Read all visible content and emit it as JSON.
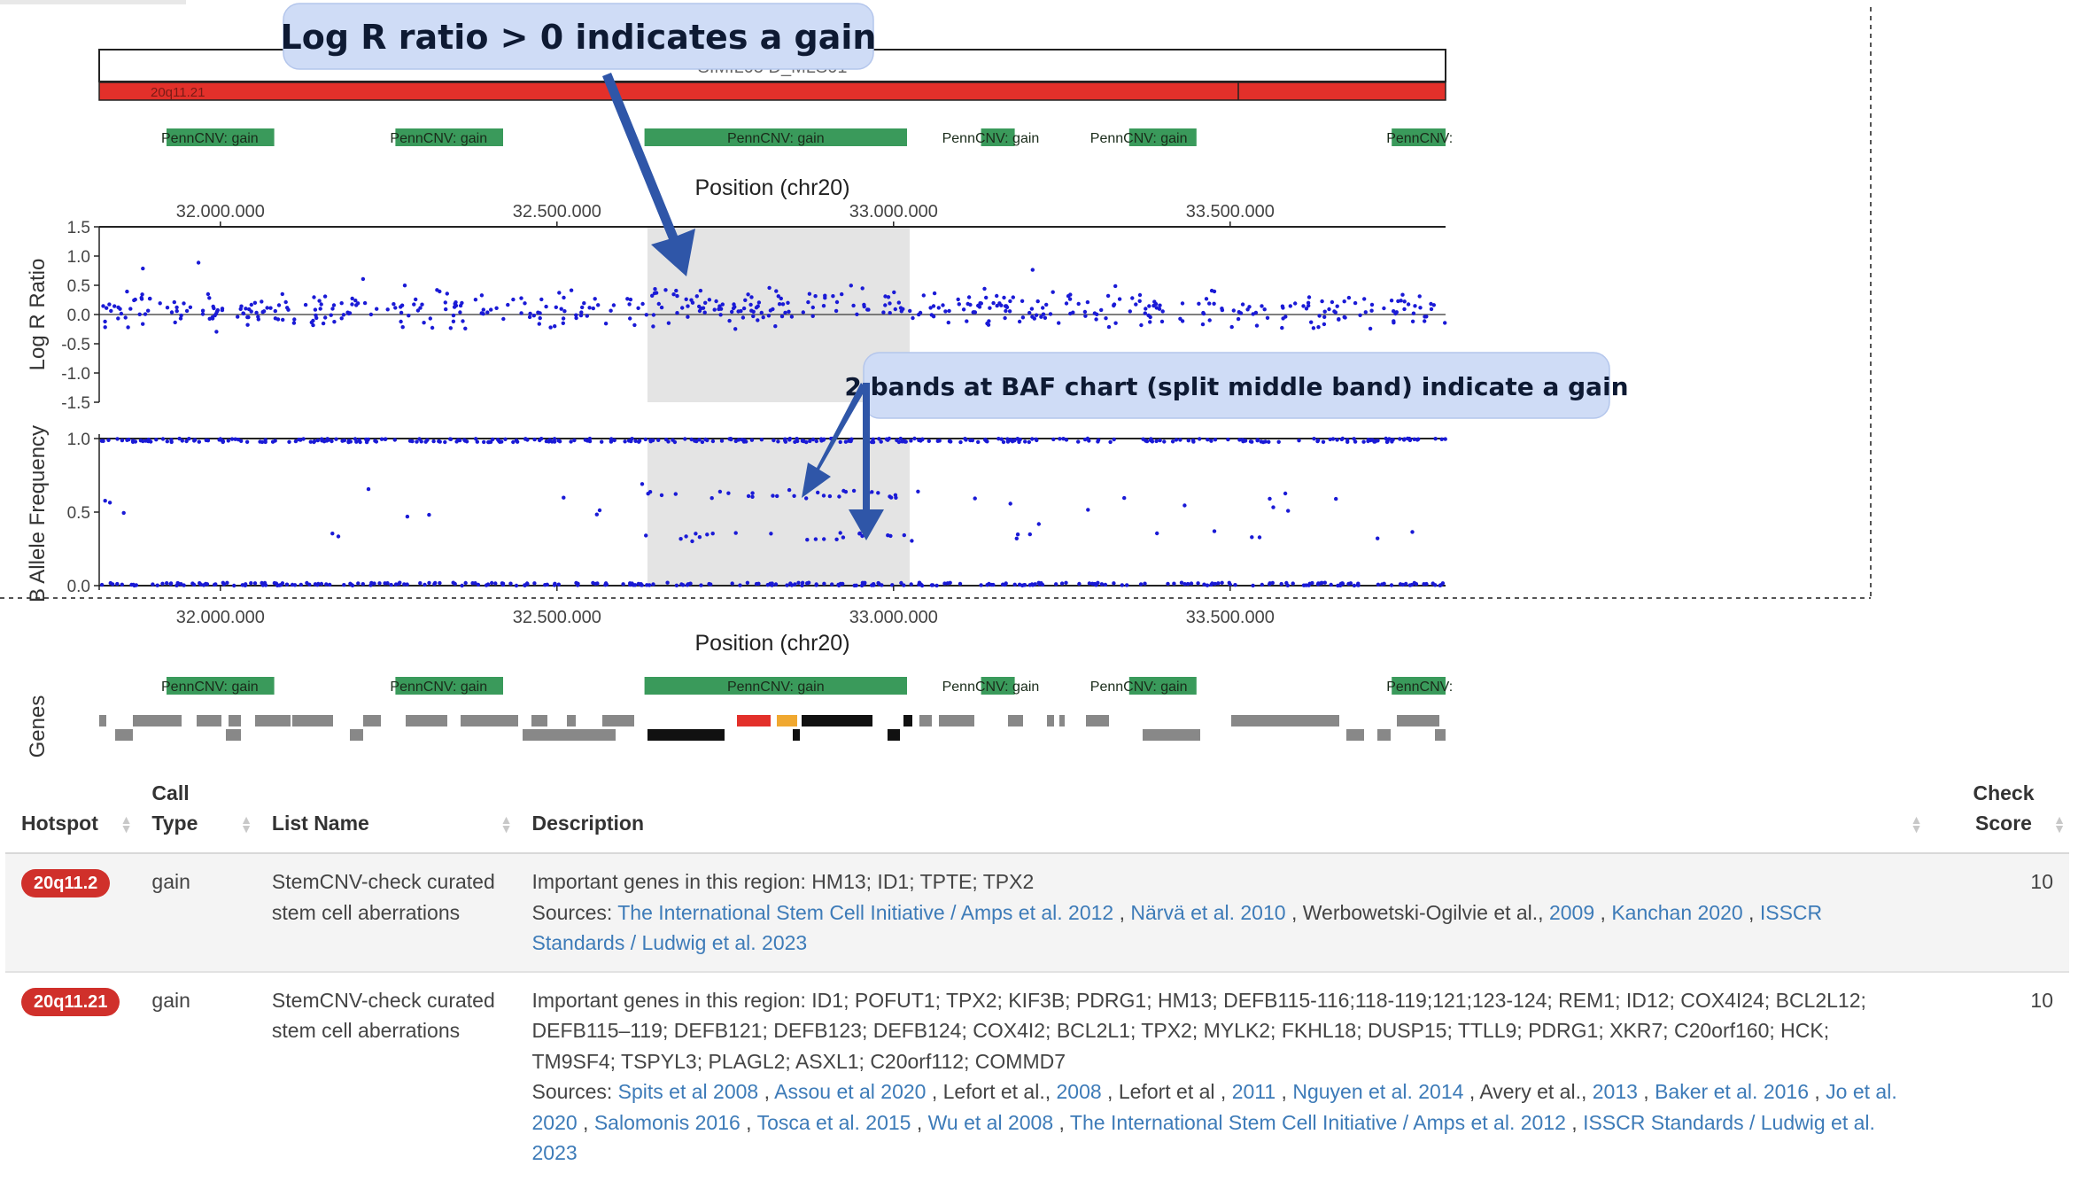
{
  "annotations": {
    "lrr_callout": "Log R ratio > 0 indicates a gain",
    "baf_callout": "2 bands at BAF chart (split middle band) indicate a gain"
  },
  "plot": {
    "cytoband_title": "SIMIL05 D_MLS01",
    "cytoband_label": "20q11.21",
    "call_track_labels": [
      "PennCNV: gain",
      "PennCNV: gain",
      "PennCNV: gain",
      "PennCNV: gain",
      "PennCNV: gain",
      "PennCNV:"
    ],
    "axis_title": "Position (chr20)",
    "x_ticks": [
      "32.000.000",
      "32.500.000",
      "33.000.000",
      "33.500.000"
    ],
    "lrr_ylabel": "Log R Ratio",
    "lrr_ticks": [
      "1.5",
      "1.0",
      "0.5",
      "0.0",
      "-0.5",
      "-1.0",
      "-1.5"
    ],
    "baf_ylabel": "B Allele Frequency",
    "baf_ticks": [
      "1.0",
      "0.5",
      "0.0"
    ],
    "genes_ylabel": "Genes"
  },
  "chart_data": [
    {
      "type": "scatter",
      "xlabel": "Position (chr20)",
      "ylabel": "Log R Ratio",
      "xlim": [
        31820000,
        33820000
      ],
      "ylim": [
        -1.5,
        1.5
      ],
      "highlight_region": [
        32630000,
        33020000
      ],
      "series": [
        {
          "color": "#1a1ad6",
          "description_points": "mostly between -0.2 and 0.3, centered slightly above 0"
        }
      ]
    },
    {
      "type": "scatter",
      "xlabel": "Position (chr20)",
      "ylabel": "B Allele Frequency",
      "xlim": [
        31820000,
        33820000
      ],
      "ylim": [
        0,
        1
      ],
      "highlight_region": [
        32630000,
        33020000
      ],
      "bands": [
        0.0,
        0.33,
        0.5,
        0.67,
        1.0
      ]
    }
  ],
  "table": {
    "headers": {
      "hotspot": "Hotspot",
      "call_type": "Call Type",
      "list_name": "List Name",
      "description": "Description",
      "check_score": "Check Score"
    },
    "rows": [
      {
        "hotspot": "20q11.2",
        "call_type": "gain",
        "list_name": "StemCNV-check curated stem cell aberrations",
        "genes_prefix": "Important genes in this region: ",
        "genes": "HM13; ID1; TPTE; TPX2",
        "sources_prefix": "Sources: ",
        "sources": [
          {
            "text": "The International Stem Cell Initiative / Amps et al. 2012",
            "link": true
          },
          {
            "text": " , ",
            "link": false
          },
          {
            "text": "Närvä et al. 2010",
            "link": true
          },
          {
            "text": " , Werbowetski-Ogilvie et al., ",
            "link": false
          },
          {
            "text": "2009",
            "link": true
          },
          {
            "text": " , ",
            "link": false
          },
          {
            "text": "Kanchan 2020",
            "link": true
          },
          {
            "text": " , ",
            "link": false
          },
          {
            "text": "ISSCR Standards / Ludwig et al. 2023",
            "link": true
          }
        ],
        "score": "10"
      },
      {
        "hotspot": "20q11.21",
        "call_type": "gain",
        "list_name": "StemCNV-check curated stem cell aberrations",
        "genes_prefix": "Important genes in this region: ",
        "genes": "ID1; POFUT1; TPX2; KIF3B; PDRG1; HM13; DEFB115-116;118-119;121;123-124; REM1; ID12; COX4I24; BCL2L12; DEFB115–119; DEFB121; DEFB123; DEFB124; COX4I2; BCL2L1; TPX2; MYLK2; FKHL18; DUSP15; TTLL9; PDRG1; XKR7; C20orf160; HCK; TM9SF4; TSPYL3; PLAGL2; ASXL1; C20orf112; COMMD7",
        "sources_prefix": "Sources: ",
        "sources": [
          {
            "text": "Spits et al 2008",
            "link": true
          },
          {
            "text": " , ",
            "link": false
          },
          {
            "text": "Assou et al 2020",
            "link": true
          },
          {
            "text": " , Lefort et al., ",
            "link": false
          },
          {
            "text": "2008",
            "link": true
          },
          {
            "text": " , Lefort et al , ",
            "link": false
          },
          {
            "text": "2011",
            "link": true
          },
          {
            "text": " , ",
            "link": false
          },
          {
            "text": "Nguyen et al. 2014",
            "link": true
          },
          {
            "text": " , Avery et al., ",
            "link": false
          },
          {
            "text": "2013",
            "link": true
          },
          {
            "text": " , ",
            "link": false
          },
          {
            "text": "Baker et al. 2016",
            "link": true
          },
          {
            "text": " , ",
            "link": false
          },
          {
            "text": "Jo et al. 2020",
            "link": true
          },
          {
            "text": " , ",
            "link": false
          },
          {
            "text": "Salomonis 2016",
            "link": true
          },
          {
            "text": " , ",
            "link": false
          },
          {
            "text": "Tosca et al. 2015",
            "link": true
          },
          {
            "text": " , ",
            "link": false
          },
          {
            "text": "Wu et al 2008",
            "link": true
          },
          {
            "text": " , ",
            "link": false
          },
          {
            "text": "The International Stem Cell Initiative / Amps et al. 2012",
            "link": true
          },
          {
            "text": " , ",
            "link": false
          },
          {
            "text": "ISSCR Standards / Ludwig et al. 2023",
            "link": true
          }
        ],
        "score": "10"
      }
    ]
  },
  "colors": {
    "points": "#1a1ad6",
    "cnv_call": "#3a9a5b",
    "cytoband": "#e3302a",
    "highlight": "#e4e4e4",
    "callout_bg": "#cfdcf6",
    "arrow": "#2f56a8",
    "link": "#3d7bb8",
    "badge": "#d0302b"
  }
}
